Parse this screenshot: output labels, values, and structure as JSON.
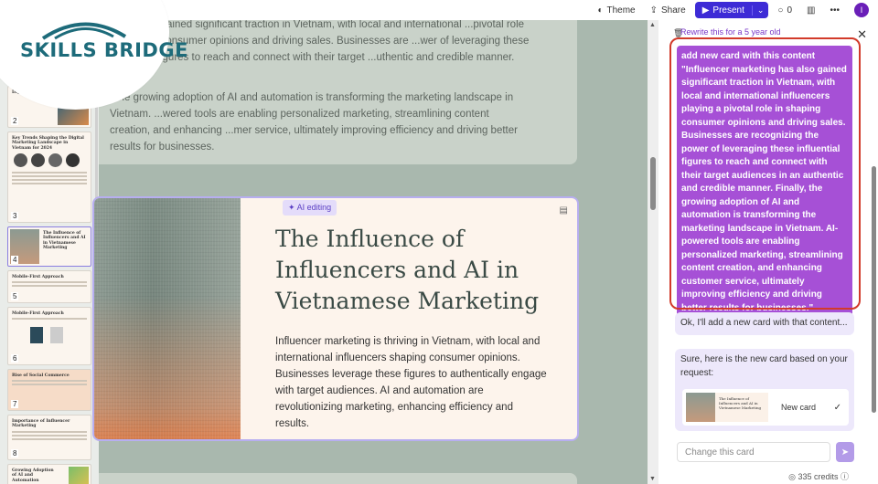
{
  "logo": {
    "text": "SKILLS BRIDGE"
  },
  "topbar": {
    "theme_label": "Theme",
    "share_label": "Share",
    "present_label": "Present",
    "comments_count": "0",
    "avatar_initial": "I"
  },
  "canvas": {
    "upper_para1": "...has also gained significant traction in Vietnam, with local and international ...pivotal role in shaping consumer opinions and driving sales. Businesses are ...wer of leveraging these influential figures to reach and connect with their target ...uthentic and credible manner.",
    "upper_para2": "...he growing adoption of AI and automation is transforming the marketing landscape in Vietnam. ...wered tools are enabling personalized marketing, streamlining content creation, and enhancing ...mer service, ultimately improving efficiency and driving better results for businesses.",
    "ai_badge": "AI editing",
    "card_title": "The Influence of Influencers and AI in Vietnamese Marketing",
    "card_body": "Influencer marketing is thriving in Vietnam, with local and international influencers shaping consumer opinions. Businesses leverage these figures to authentically engage with target audiences. AI and automation are revolutionizing marketing, enhancing efficiency and results."
  },
  "thumbs": [
    {
      "num": "2",
      "title": "Dig... Vietn..."
    },
    {
      "num": "3",
      "title": "Key Trends Shaping the Digital Marketing Landscape in Vietnam for 2024"
    },
    {
      "num": "4",
      "title": "The Influence of Influencers and AI in Vietnamese Marketing"
    },
    {
      "num": "5",
      "title": "Mobile-First Approach"
    },
    {
      "num": "6",
      "title": "Mobile-First Approach"
    },
    {
      "num": "7",
      "title": "Rise of Social Commerce"
    },
    {
      "num": "8",
      "title": "Importance of Influencer Marketing"
    },
    {
      "num": "",
      "title": "Growing Adoption of AI and Automation"
    }
  ],
  "chat": {
    "hint": "Rewrite this for a 5 year old",
    "user_message": "add new card with this content \"Influencer marketing has also gained significant traction in Vietnam, with local and international influencers playing a pivotal role in shaping consumer opinions and driving sales. Businesses are recognizing the power of leveraging these influential figures to reach and connect with their target audiences in an authentic and credible manner. Finally, the growing adoption of AI and automation is transforming the marketing landscape in Vietnam. AI-powered tools are enabling personalized marketing, streamlining content creation, and enhancing customer service, ultimately improving efficiency and driving better results for businesses.\"",
    "bot_reply1": "Ok, I'll add a new card with that content...",
    "bot_reply2": "Sure, here is the new card based on your request:",
    "new_card_label": "New card",
    "new_card_thumb_title": "The Influence of Influencers and AI in Vietnamese Marketing",
    "input_placeholder": "Change this card",
    "credits": "335 credits"
  }
}
